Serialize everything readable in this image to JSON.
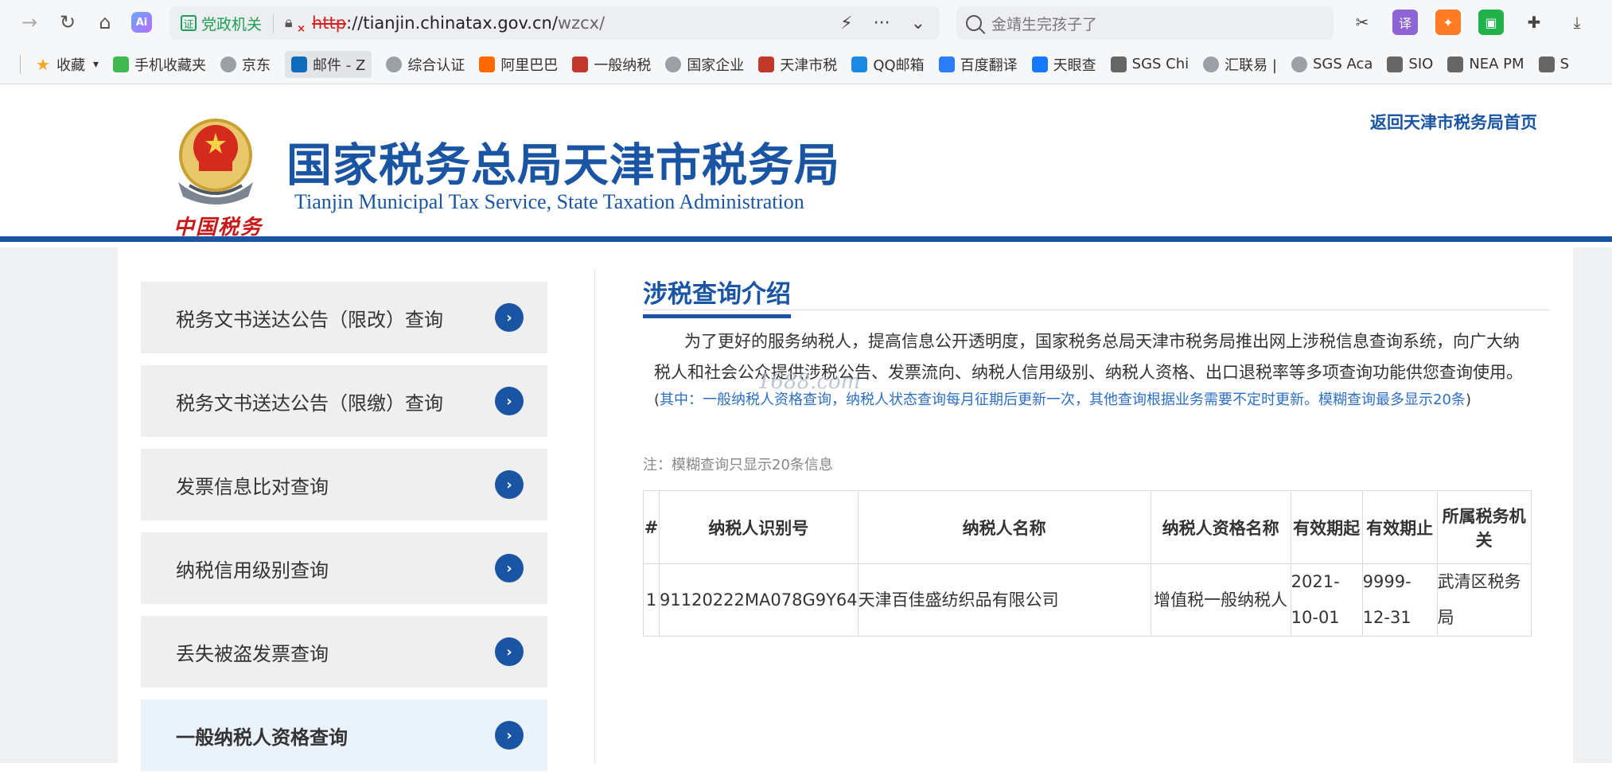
{
  "browser": {
    "gov_tag": "党政机关",
    "url_proto": "http",
    "url_host": "://tianjin.chinatax.gov.cn/",
    "url_path": "wzcx/",
    "search_placeholder": "金靖生完孩子了",
    "ai_label": "Ai"
  },
  "bookmarks": [
    {
      "label": "收藏",
      "color": "#f5a623",
      "icon": "star-icon"
    },
    {
      "label": "手机收藏夹",
      "color": "#3fb950",
      "icon": "phone-icon"
    },
    {
      "label": "京东",
      "color": "#9aa0a6",
      "icon": "globe-icon"
    },
    {
      "label": "邮件 - Z",
      "color": "#0f6cbd",
      "icon": "outlook-icon"
    },
    {
      "label": "综合认证",
      "color": "#9aa0a6",
      "icon": "globe-icon"
    },
    {
      "label": "阿里巴巴",
      "color": "#ff6a00",
      "icon": "alibaba-icon"
    },
    {
      "label": "一般纳税",
      "color": "#c0392b",
      "icon": "emblem-icon"
    },
    {
      "label": "国家企业",
      "color": "#9aa0a6",
      "icon": "globe-icon"
    },
    {
      "label": "天津市税",
      "color": "#c0392b",
      "icon": "emblem-icon"
    },
    {
      "label": "QQ邮箱",
      "color": "#1e88e5",
      "icon": "qq-icon"
    },
    {
      "label": "百度翻译",
      "color": "#2b7cf6",
      "icon": "translate-icon"
    },
    {
      "label": "天眼查",
      "color": "#1677ff",
      "icon": "tianyancha-icon"
    },
    {
      "label": "SGS Chi",
      "color": "#666666",
      "icon": "doc-icon"
    },
    {
      "label": "汇联易 |",
      "color": "#9aa0a6",
      "icon": "globe-icon"
    },
    {
      "label": "SGS Aca",
      "color": "#9aa0a6",
      "icon": "globe-icon"
    },
    {
      "label": "SIO",
      "color": "#666666",
      "icon": "doc-icon"
    },
    {
      "label": "NEA PM",
      "color": "#666666",
      "icon": "doc-icon"
    },
    {
      "label": "S",
      "color": "#666666",
      "icon": "doc-icon"
    }
  ],
  "header": {
    "cn_title": "国家税务总局天津市税务局",
    "en_title": "Tianjin Municipal Tax Service, State Taxation Administration",
    "emblem_caption": "中国税务",
    "return_link": "返回天津市税务局首页"
  },
  "sidebar": {
    "items": [
      {
        "label": "税务文书送达公告（限改）查询"
      },
      {
        "label": "税务文书送达公告（限缴）查询"
      },
      {
        "label": "发票信息比对查询"
      },
      {
        "label": "纳税信用级别查询"
      },
      {
        "label": "丢失被盗发票查询"
      },
      {
        "label": "一般纳税人资格查询"
      }
    ]
  },
  "main": {
    "title": "涉税查询介绍",
    "intro": "为了更好的服务纳税人，提高信息公开透明度，国家税务总局天津市税务局推出网上涉税信息查询系统，向广大纳税人和社会公众提供涉税公告、发票流向、纳税人信用级别、纳税人资格、出口退税率等多项查询功能供您查询使用。",
    "note_open": "(",
    "note": "其中：一般纳税人资格查询，纳税人状态查询每月征期后更新一次，其他查询根据业务需要不定时更新。模糊查询最多显示20条",
    "note_close": ")",
    "hint": "注：模糊查询只显示20条信息",
    "watermark": "1688.com"
  },
  "table": {
    "headers": [
      "#",
      "纳税人识别号",
      "纳税人名称",
      "纳税人资格名称",
      "有效期起",
      "有效期止",
      "所属税务机关"
    ],
    "rows": [
      [
        "1",
        "91120222MA078G9Y64",
        "天津百佳盛纺织品有限公司",
        "增值税一般纳税人",
        "2021-10-01",
        "9999-12-31",
        "武清区税务局"
      ]
    ]
  }
}
